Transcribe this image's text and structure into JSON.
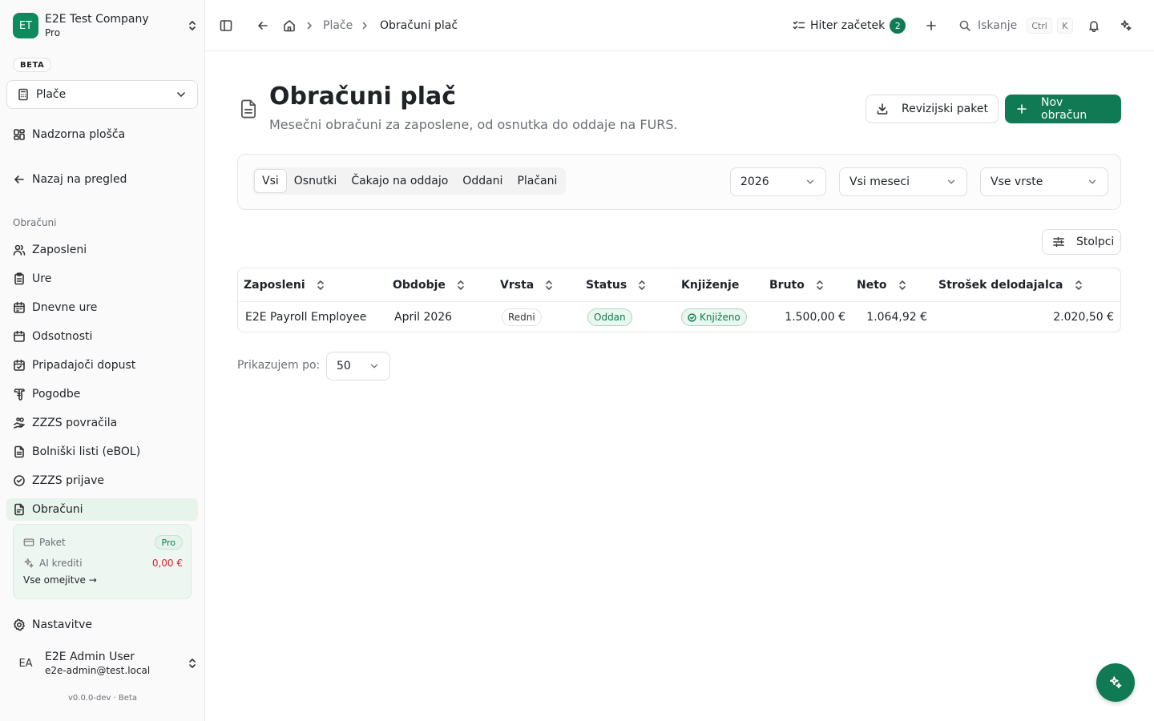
{
  "company": {
    "initials": "ET",
    "name": "E2E Test Company",
    "plan": "Pro"
  },
  "beta_label": "BETA",
  "module": {
    "label": "Plače"
  },
  "nav": {
    "dashboard": "Nadzorna plošča",
    "back": "Nazaj na pregled",
    "section_label": "Obračuni",
    "items": [
      {
        "label": "Zaposleni",
        "icon": "users-icon"
      },
      {
        "label": "Ure",
        "icon": "clipboard-icon"
      },
      {
        "label": "Dnevne ure",
        "icon": "calendar-clock-icon"
      },
      {
        "label": "Odsotnosti",
        "icon": "calendar-icon"
      },
      {
        "label": "Pripadajoči dopust",
        "icon": "calendar-check-icon"
      },
      {
        "label": "Pogodbe",
        "icon": "scroll-icon"
      },
      {
        "label": "ZZZS povračila",
        "icon": "hand-coins-icon"
      },
      {
        "label": "Bolniški listi (eBOL)",
        "icon": "file-text-icon"
      },
      {
        "label": "ZZZS prijave",
        "icon": "circle-check-icon"
      },
      {
        "label": "Obračuni",
        "icon": "receipt-icon",
        "active": true
      }
    ],
    "settings": "Nastavitve"
  },
  "plan_card": {
    "package_label": "Paket",
    "package_value": "Pro",
    "credits_label": "AI krediti",
    "credits_value": "0,00 €",
    "limits_link": "Vse omejitve →"
  },
  "user": {
    "initials": "EA",
    "name": "E2E Admin User",
    "email": "e2e-admin@test.local"
  },
  "version": "v0.0.0-dev · Beta",
  "topbar": {
    "breadcrumb": [
      "Plače",
      "Obračuni plač"
    ],
    "quick_start_label": "Hiter začetek",
    "quick_start_count": "2",
    "search_placeholder": "Iskanje",
    "shortcut": [
      "Ctrl",
      "K"
    ]
  },
  "page": {
    "title": "Obračuni plač",
    "subtitle": "Mesečni obračuni za zaposlene, od osnutka do oddaje na FURS.",
    "audit_button": "Revizijski paket",
    "new_button": "Nov obračun"
  },
  "filters": {
    "tabs": [
      "Vsi",
      "Osnutki",
      "Čakajo na oddajo",
      "Oddani",
      "Plačani"
    ],
    "active_tab": "Vsi",
    "year": "2026",
    "month": "Vsi meseci",
    "type": "Vse vrste"
  },
  "columns_button": "Stolpci",
  "table": {
    "headers": [
      "Zaposleni",
      "Obdobje",
      "Vrsta",
      "Status",
      "Knjiženje",
      "Bruto",
      "Neto",
      "Strošek delodajalca"
    ],
    "rows": [
      {
        "employee": "E2E Payroll Employee",
        "period": "April 2026",
        "type": "Redni",
        "status": "Oddan",
        "posting": "Knjiženo",
        "gross": "1.500,00 €",
        "net": "1.064,92 €",
        "employer_cost": "2.020,50 €"
      }
    ]
  },
  "pager": {
    "label": "Prikazujem po:",
    "value": "50"
  }
}
